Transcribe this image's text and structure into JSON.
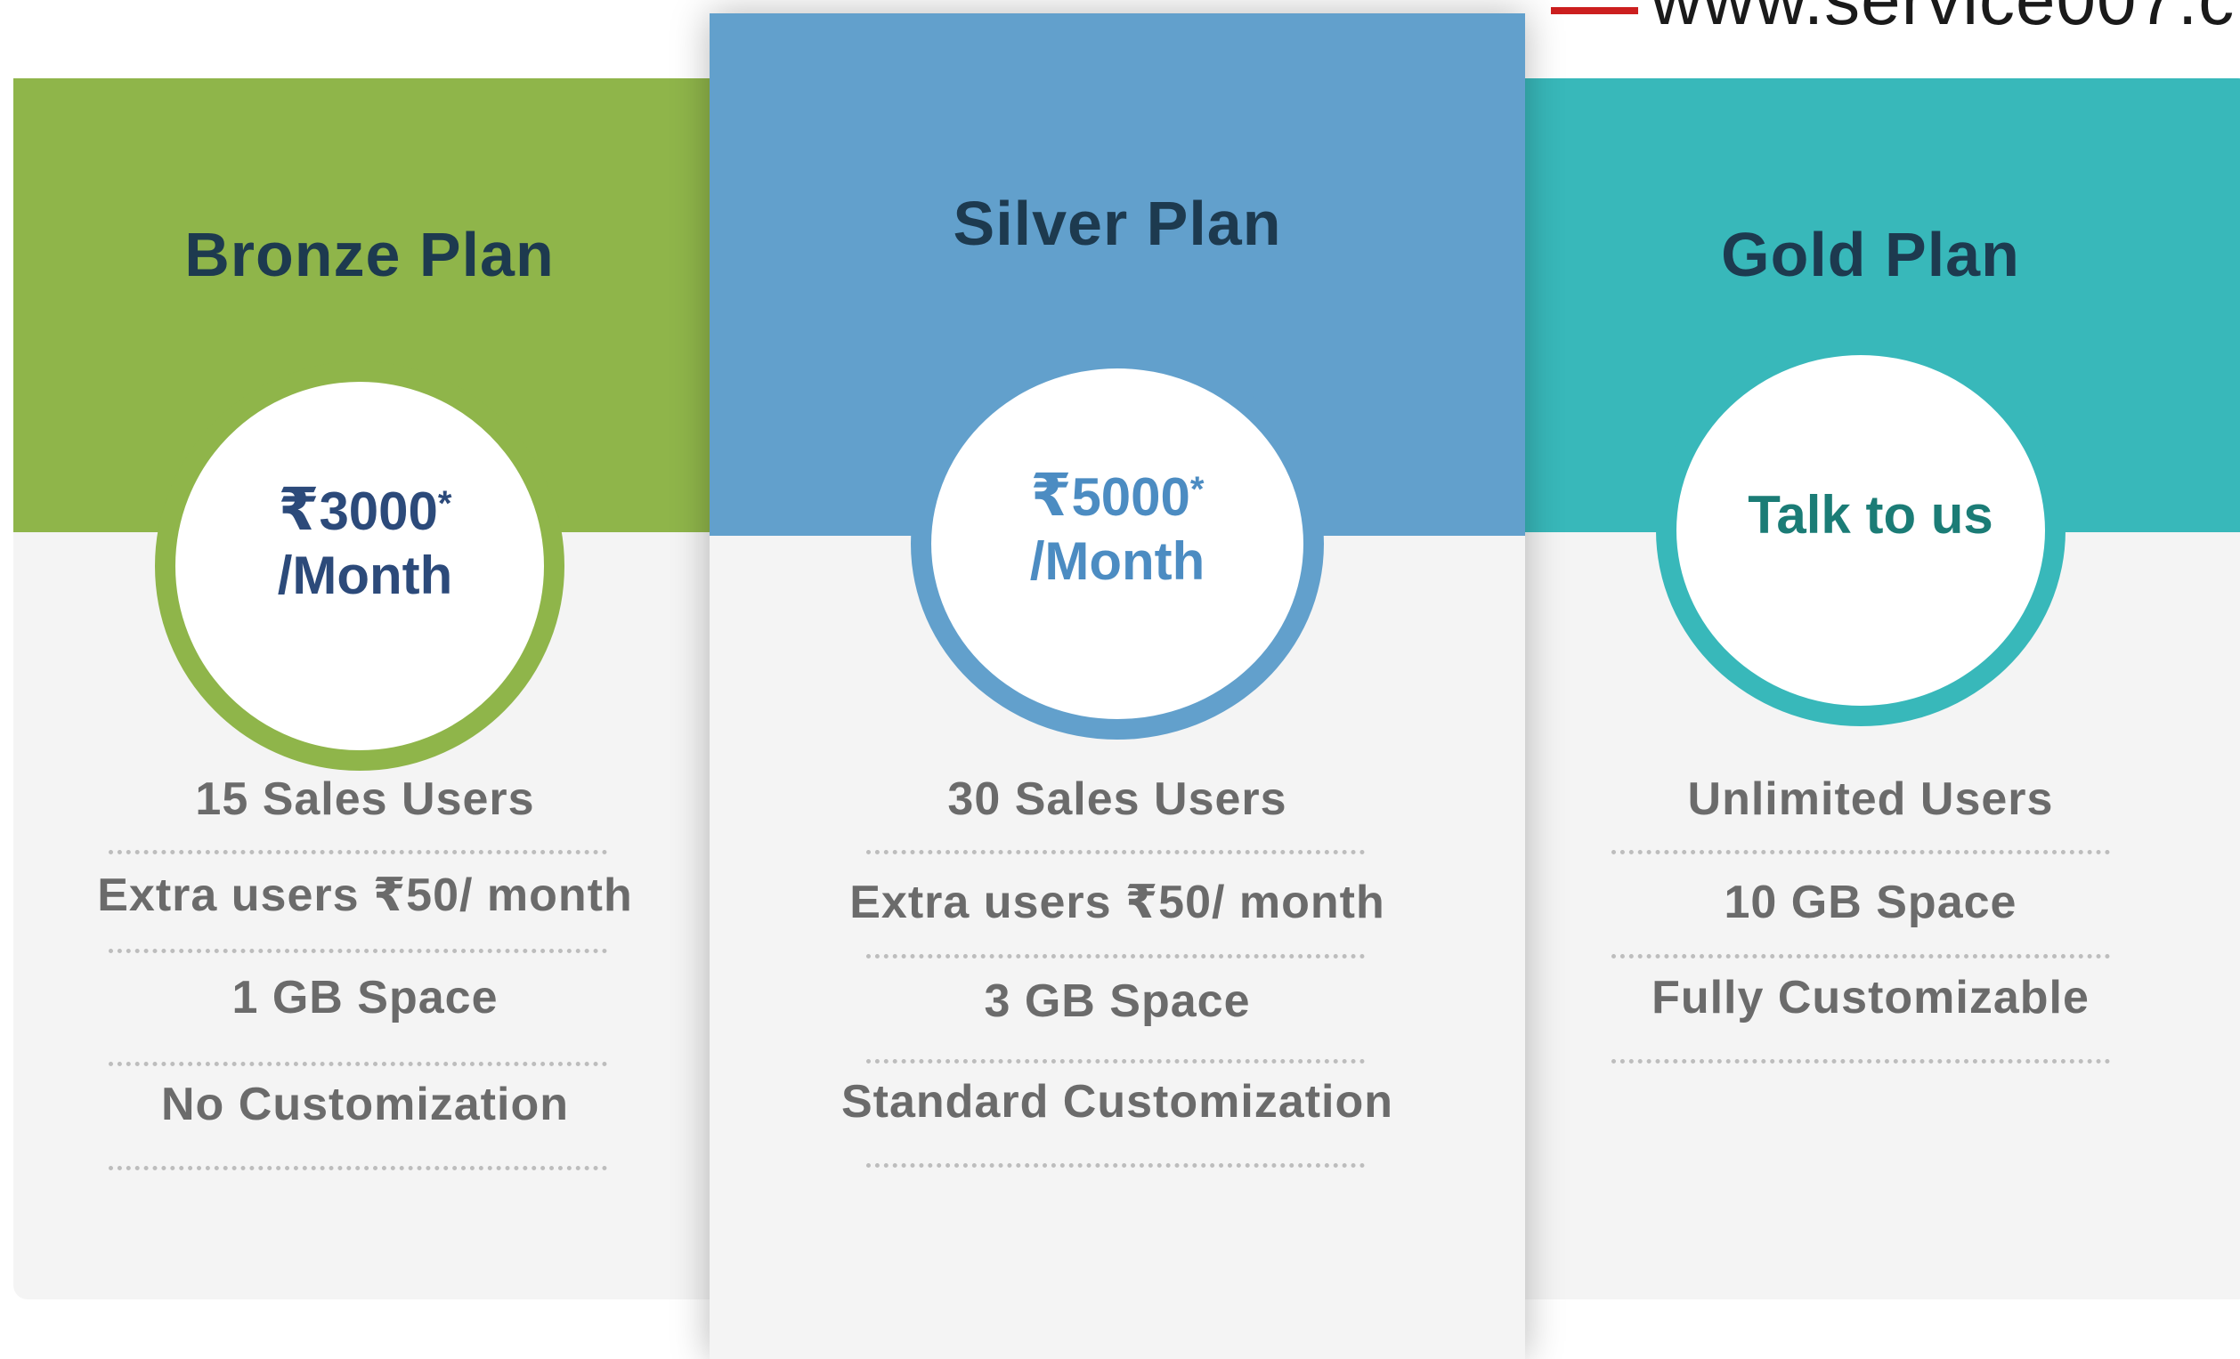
{
  "banner": {
    "url_text": "www.service007.c",
    "accent": "#cc1f1f"
  },
  "colors": {
    "bronze": "#8fb54a",
    "silver": "#62a0cc",
    "gold": "#38b8ba",
    "title_text": "#1d3a4f",
    "bronze_price": "#2c4a7a",
    "silver_price": "#4c8cc2",
    "gold_price": "#1b7c76",
    "feature_text": "#6b6b6b"
  },
  "plans": [
    {
      "name": "Bronze Plan",
      "currency": "₹",
      "amount": "3000",
      "asterisk": "*",
      "period": "/Month",
      "features": [
        "15 Sales Users",
        "Extra users ₹50/ month",
        "1 GB Space",
        "No Customization"
      ]
    },
    {
      "name": "Silver Plan",
      "currency": "₹",
      "amount": "5000",
      "asterisk": "*",
      "period": "/Month",
      "features": [
        "30 Sales Users",
        "Extra users ₹50/ month",
        "3 GB Space",
        "Standard Customization"
      ]
    },
    {
      "name": "Gold Plan",
      "cta": "Talk to us",
      "features": [
        "Unlimited Users",
        "10 GB Space",
        "Fully Customizable"
      ]
    }
  ]
}
